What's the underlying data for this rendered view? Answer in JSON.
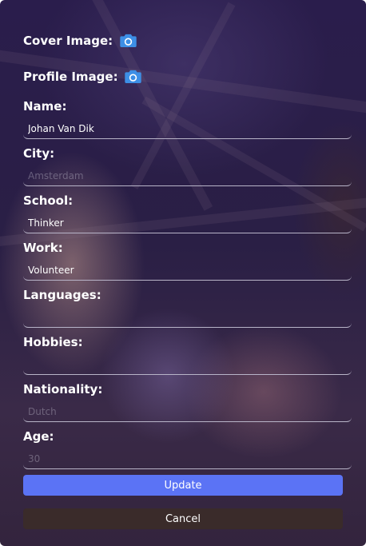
{
  "form": {
    "cover_label": "Cover Image:",
    "profile_label": "Profile Image:",
    "fields": [
      {
        "label": "Name:",
        "value": "Johan Van Dik",
        "placeholder": ""
      },
      {
        "label": "City:",
        "value": "",
        "placeholder": "Amsterdam"
      },
      {
        "label": "School:",
        "value": "Thinker",
        "placeholder": ""
      },
      {
        "label": "Work:",
        "value": "Volunteer",
        "placeholder": ""
      },
      {
        "label": "Languages:",
        "value": "",
        "placeholder": ""
      },
      {
        "label": "Hobbies:",
        "value": "",
        "placeholder": ""
      },
      {
        "label": "Nationality:",
        "value": "",
        "placeholder": "Dutch"
      },
      {
        "label": "Age:",
        "value": "",
        "placeholder": "30"
      }
    ],
    "update_label": "Update",
    "cancel_label": "Cancel"
  },
  "icons": {
    "cover": "camera-icon",
    "profile": "camera-icon"
  },
  "colors": {
    "accent": "#5b73f5",
    "icon": "#3d8fe6",
    "cancel": "#3a2b2a",
    "overlay": "#2a1d4c"
  }
}
